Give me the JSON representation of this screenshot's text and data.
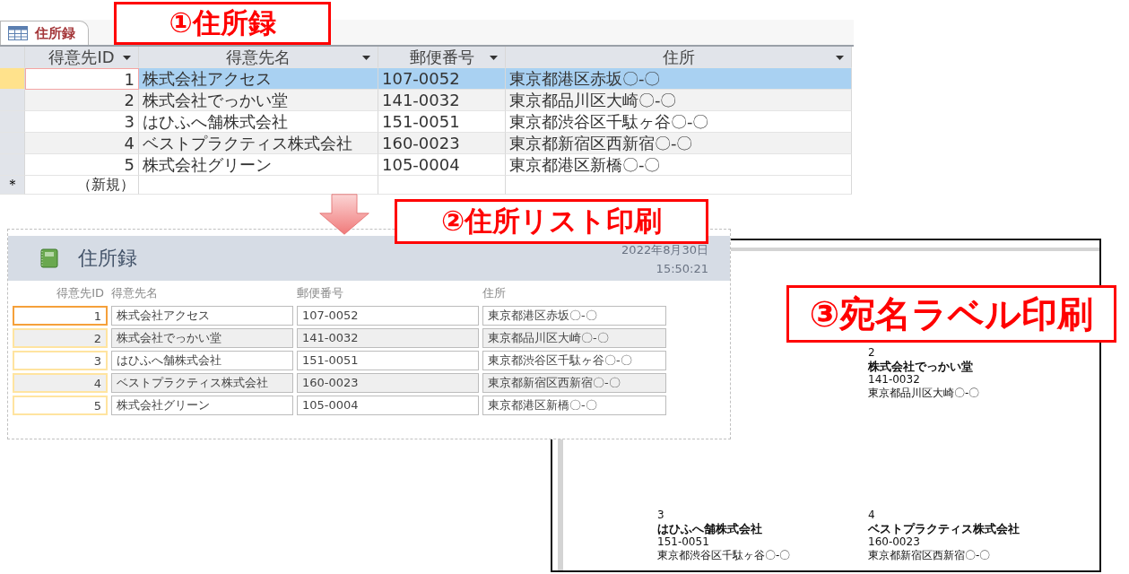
{
  "datasheet": {
    "tab": {
      "label": "住所録",
      "selected": true
    },
    "columns": [
      "得意先ID",
      "得意先名",
      "郵便番号",
      "住所"
    ],
    "rows": [
      {
        "id": "1",
        "name": "株式会社アクセス",
        "postal": "107-0052",
        "address": "東京都港区赤坂〇-〇",
        "selected": true
      },
      {
        "id": "2",
        "name": "株式会社でっかい堂",
        "postal": "141-0032",
        "address": "東京都品川区大崎〇-〇",
        "selected": false
      },
      {
        "id": "3",
        "name": "はひふへ舗株式会社",
        "postal": "151-0051",
        "address": "東京都渋谷区千駄ヶ谷〇-〇",
        "selected": false
      },
      {
        "id": "4",
        "name": "ベストプラクティス株式会社",
        "postal": "160-0023",
        "address": "東京都新宿区西新宿〇-〇",
        "selected": false
      },
      {
        "id": "5",
        "name": "株式会社グリーン",
        "postal": "105-0004",
        "address": "東京都港区新橋〇-〇",
        "selected": false
      }
    ],
    "new_row": {
      "marker": "＊",
      "label": "（新規）"
    }
  },
  "report": {
    "title": "住所録",
    "date": "2022年8月30日",
    "time": "15:50:21",
    "columns": [
      "得意先ID",
      "得意先名",
      "郵便番号",
      "住所"
    ],
    "rows": [
      {
        "id": "1",
        "name": "株式会社アクセス",
        "postal": "107-0052",
        "address": "東京都港区赤坂〇-〇",
        "selected": true
      },
      {
        "id": "2",
        "name": "株式会社でっかい堂",
        "postal": "141-0032",
        "address": "東京都品川区大崎〇-〇",
        "selected": false
      },
      {
        "id": "3",
        "name": "はひふへ舗株式会社",
        "postal": "151-0051",
        "address": "東京都渋谷区千駄ヶ谷〇-〇",
        "selected": false
      },
      {
        "id": "4",
        "name": "ベストプラクティス株式会社",
        "postal": "160-0023",
        "address": "東京都新宿区西新宿〇-〇",
        "selected": false
      },
      {
        "id": "5",
        "name": "株式会社グリーン",
        "postal": "105-0004",
        "address": "東京都港区新橋〇-〇",
        "selected": false
      }
    ]
  },
  "labels": [
    {
      "id": "2",
      "name": "株式会社でっかい堂",
      "postal": "141-0032",
      "address": "東京都品川区大崎〇-〇"
    },
    {
      "id": "3",
      "name": "はひふへ舗株式会社",
      "postal": "151-0051",
      "address": "東京都渋谷区千駄ヶ谷〇-〇"
    },
    {
      "id": "4",
      "name": "ベストプラクティス株式会社",
      "postal": "160-0023",
      "address": "東京都新宿区西新宿〇-〇"
    }
  ],
  "callouts": [
    "①住所録",
    "②住所リスト印刷",
    "③宛名ラベル印刷"
  ]
}
